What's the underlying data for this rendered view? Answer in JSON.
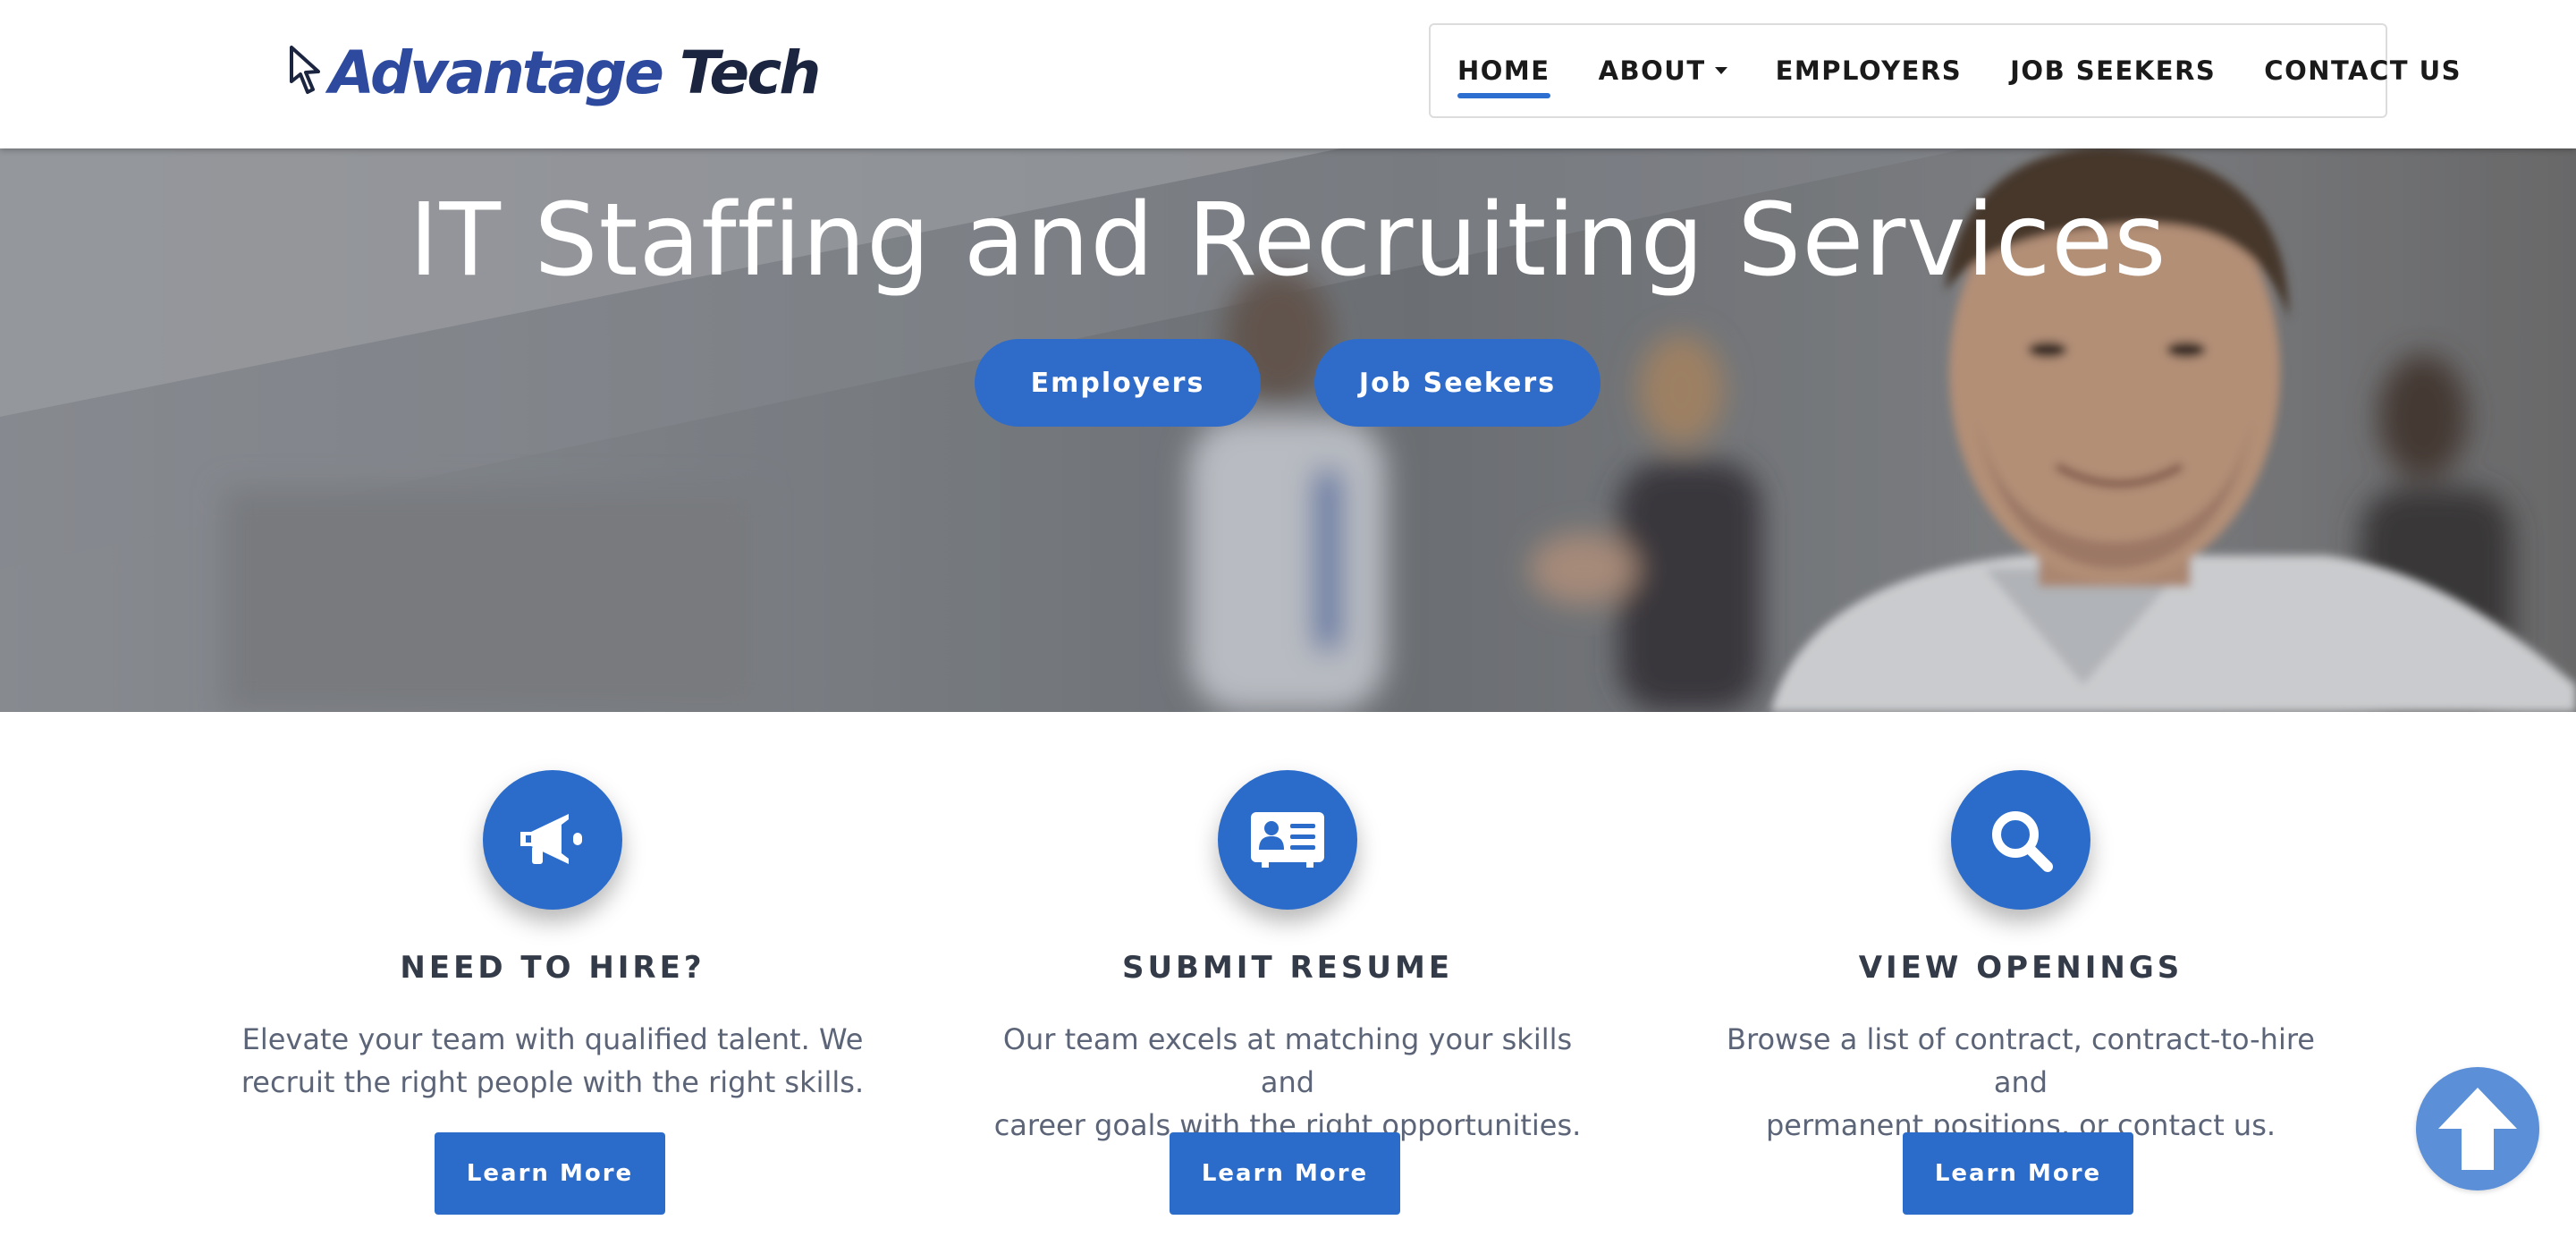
{
  "brand": {
    "word1": "Advantage",
    "word2": "Tech",
    "accent": "#2d4a9e"
  },
  "nav": {
    "items": [
      {
        "label": "HOME",
        "active": true
      },
      {
        "label": "ABOUT",
        "dropdown": true
      },
      {
        "label": "EMPLOYERS"
      },
      {
        "label": "JOB SEEKERS"
      },
      {
        "label": "CONTACT US"
      }
    ],
    "active_color": "#2d6fd0"
  },
  "hero": {
    "title": "IT Staffing and Recruiting Services",
    "buttons": [
      "Employers",
      "Job Seekers"
    ]
  },
  "features": [
    {
      "icon": "megaphone-icon",
      "heading": "NEED TO HIRE?",
      "line1": "Elevate your team with qualified talent. We",
      "line2": "recruit the right people with the right skills.",
      "button": "Learn More"
    },
    {
      "icon": "id-card-icon",
      "heading": "SUBMIT RESUME",
      "line1": "Our team excels at matching your skills and",
      "line2": "career goals with the right opportunities.",
      "button": "Learn More"
    },
    {
      "icon": "search-icon",
      "heading": "VIEW OPENINGS",
      "line1": "Browse a list of contract, contract-to-hire and",
      "line2": "permanent positions, or contact us.",
      "button": "Learn More"
    }
  ],
  "colors": {
    "primary": "#2b6ccb",
    "scroll_top": "#5b8fd8",
    "heading": "#333a48",
    "body_text": "#5c6478"
  },
  "scroll_top_icon": "arrow-up-icon"
}
